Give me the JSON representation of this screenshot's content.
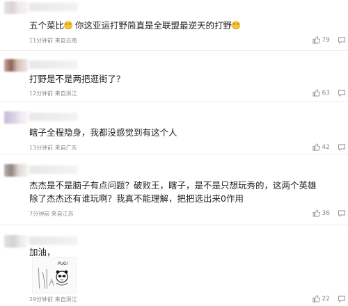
{
  "comments": [
    {
      "text": "五个菜比",
      "text_after_emoji1": " 你这亚运打野简直是全联盟最逆天的打野",
      "time": "11分钟前",
      "location": "来自云南",
      "likes": "79"
    },
    {
      "text": "打野是不是两把逛街了？",
      "time": "12分钟前",
      "location": "来自浙江",
      "likes": "63"
    },
    {
      "text": "瞎子全程隐身，我都没感觉到有这个人",
      "time": "13分钟前",
      "location": "来自广东",
      "likes": "42"
    },
    {
      "text_line1": "杰杰是不是脑子有点问题？破败王，瞎子，是不是只想玩秀的，这两个英雄",
      "text_line2": "除了杰杰还有谁玩啊？我真不能理解，把把选出来0作用",
      "time": "7分钟前",
      "location": "来自江苏",
      "likes": "36"
    },
    {
      "text": "加油，",
      "meme_text": "PUG!",
      "time": "29分钟前",
      "location": "来自浙江",
      "likes": "22"
    }
  ],
  "icons": {
    "like": "thumbs-up-icon",
    "reply": "comment-bubble-icon"
  },
  "colors": {
    "meta": "#8a8a8a",
    "text": "#222222",
    "divider": "#ececec"
  }
}
